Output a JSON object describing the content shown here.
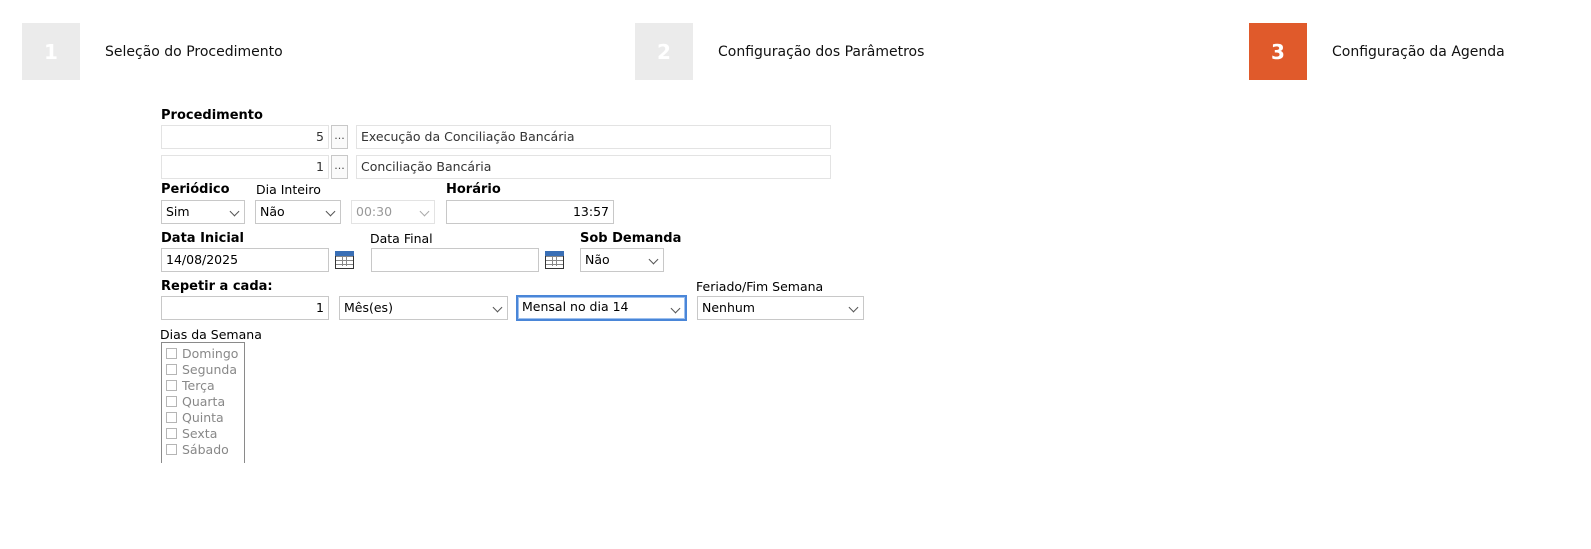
{
  "wizard": {
    "steps": [
      {
        "number": "1",
        "label": "Seleção do Procedimento"
      },
      {
        "number": "2",
        "label": "Configuração dos Parâmetros"
      },
      {
        "number": "3",
        "label": "Configuração da Agenda"
      }
    ],
    "active_step": "3"
  },
  "form": {
    "procedimento": {
      "label": "Procedimento",
      "row1_code": "5",
      "row1_desc": "Execução da Conciliação Bancária",
      "row2_code": "1",
      "row2_desc": "Conciliação Bancária",
      "lookup_label": "..."
    },
    "periodico": {
      "label": "Periódico",
      "value": "Sim"
    },
    "dia_inteiro": {
      "label": "Dia Inteiro",
      "value": "Não",
      "duration": "00:30"
    },
    "horario": {
      "label": "Horário",
      "value": "13:57"
    },
    "data_inicial": {
      "label": "Data Inicial",
      "value": "14/08/2025"
    },
    "data_final": {
      "label": "Data Final",
      "value": ""
    },
    "sob_demanda": {
      "label": "Sob Demanda",
      "value": "Não"
    },
    "repetir": {
      "label": "Repetir a cada:",
      "quantity": "1",
      "unit": "Mês(es)",
      "mode": "Mensal no dia 14"
    },
    "feriado": {
      "label": "Feriado/Fim Semana",
      "value": "Nenhum"
    },
    "dias_semana": {
      "label": "Dias da Semana",
      "days": [
        "Domingo",
        "Segunda",
        "Terça",
        "Quarta",
        "Quinta",
        "Sexta",
        "Sábado"
      ]
    }
  },
  "colors": {
    "active_step": "#e05a2b",
    "inactive_step": "#ebebeb",
    "focus_border": "#4a86d8"
  }
}
